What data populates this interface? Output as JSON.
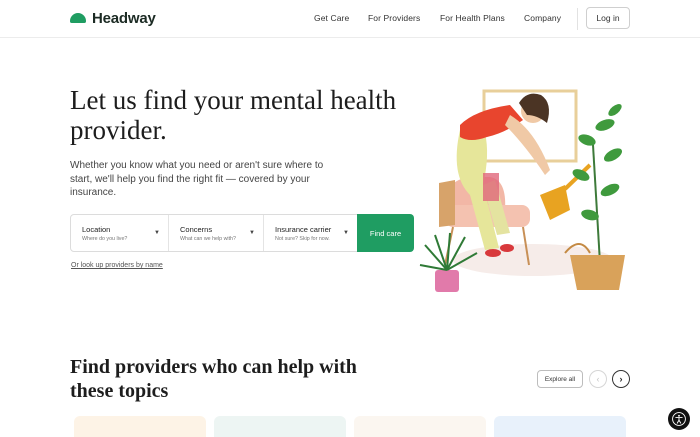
{
  "header": {
    "brand": "Headway",
    "nav": [
      "Get Care",
      "For Providers",
      "For Health Plans",
      "Company"
    ],
    "login_label": "Log in"
  },
  "hero": {
    "title": "Let us find your mental health provider.",
    "subtitle": "Whether you know what you need or aren't sure where to start, we'll help you find the right fit — covered by your insurance.",
    "search": {
      "fields": [
        {
          "label": "Location",
          "hint": "Where do you live?"
        },
        {
          "label": "Concerns",
          "hint": "What can we help with?"
        },
        {
          "label": "Insurance carrier",
          "hint": "Not sure? Skip for now."
        }
      ],
      "button_label": "Find care"
    },
    "lookup_link": "Or look up providers by name"
  },
  "topics": {
    "title": "Find providers who can help with these topics",
    "explore_label": "Explore all",
    "prev_icon": "chevron-left-icon",
    "next_icon": "chevron-right-icon"
  },
  "colors": {
    "brand_green": "#1f9d62",
    "card_colors": [
      "#fdf3e6",
      "#edf5f3",
      "#fbf6f0",
      "#e8f1fb"
    ]
  },
  "icons": {
    "logo": "headway-logo-icon",
    "accessibility": "accessibility-icon",
    "dropdown": "chevron-down-icon"
  }
}
